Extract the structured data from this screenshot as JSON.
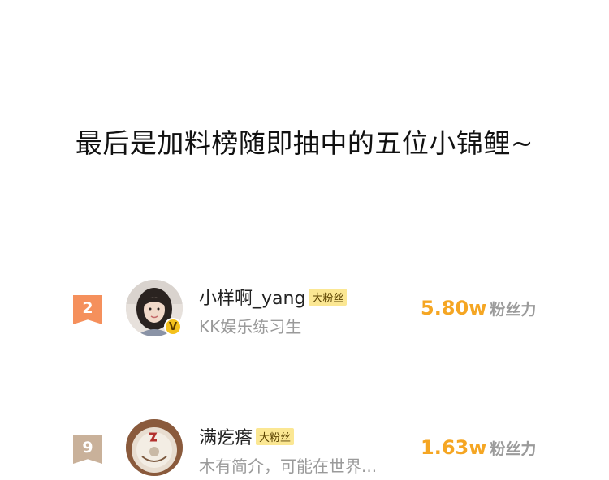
{
  "headline": "最后是加料榜随即抽中的五位小锦鲤~",
  "colors": {
    "accent_orange": "#f5a623",
    "rank_orange": "#f5905c",
    "rank_beige": "#c9b19a",
    "badge_yellow": "#fbe793"
  },
  "entries": [
    {
      "rank": "2",
      "name": "小样啊_yang",
      "badge": "大粉丝",
      "subtitle": "KK娱乐练习生",
      "fan_power": "5.80w",
      "fan_power_label": "粉丝力",
      "verified_mark": "V",
      "avatar_icon": "avatar-photo-icon"
    },
    {
      "rank": "9",
      "name": "满疙瘩",
      "badge": "大粉丝",
      "subtitle": "木有简介，可能在世界...",
      "fan_power": "1.63w",
      "fan_power_label": "粉丝力",
      "avatar_icon": "avatar-photo-icon"
    }
  ]
}
